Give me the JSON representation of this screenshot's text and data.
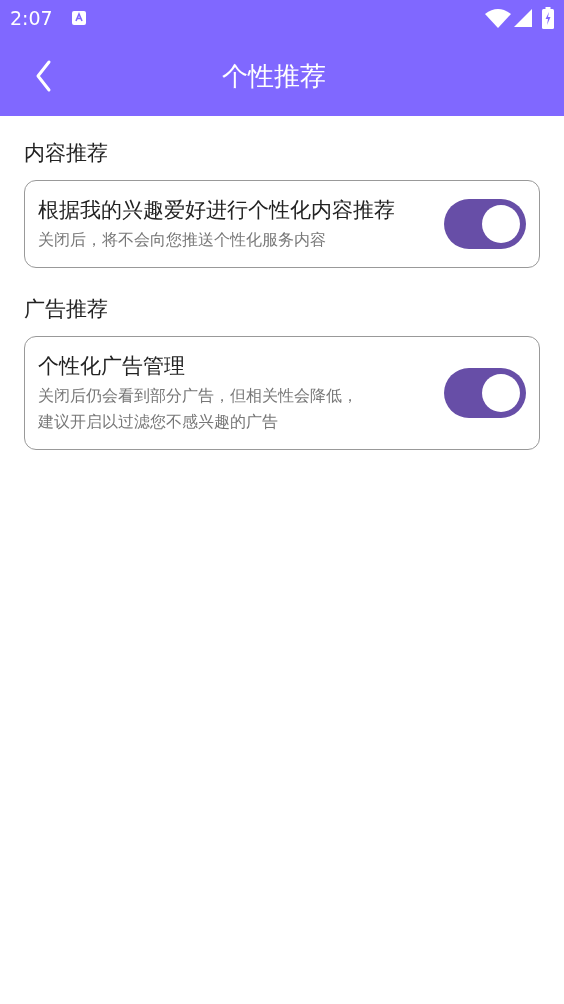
{
  "status_bar": {
    "time": "2:07"
  },
  "app_bar": {
    "title": "个性推荐"
  },
  "sections": [
    {
      "heading": "内容推荐",
      "items": [
        {
          "title": "根据我的兴趣爱好进行个性化内容推荐",
          "description": "关闭后，将不会向您推送个性化服务内容",
          "on": true
        }
      ]
    },
    {
      "heading": "广告推荐",
      "items": [
        {
          "title": "个性化广告管理",
          "description": "关闭后仍会看到部分广告，但相关性会降低，建议开启以过滤您不感兴趣的广告",
          "on": true
        }
      ]
    }
  ]
}
